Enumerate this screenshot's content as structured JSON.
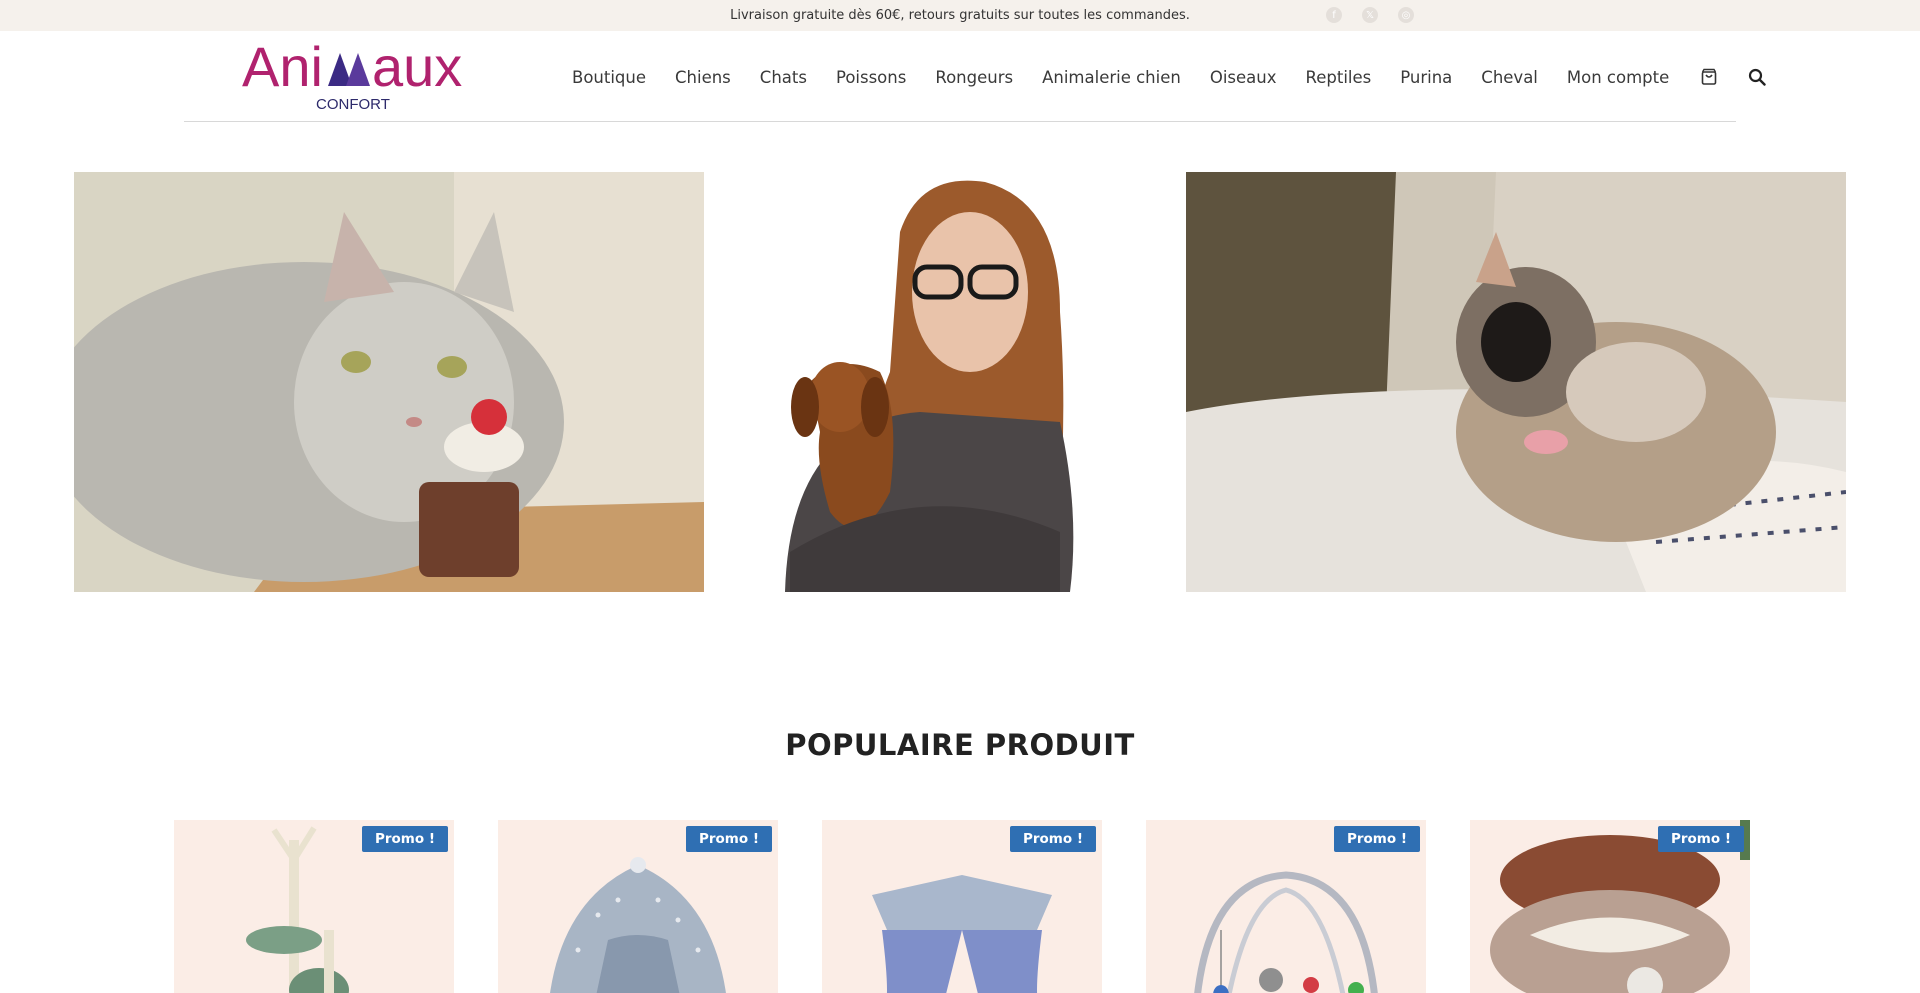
{
  "topbar": {
    "message": "Livraison gratuite dès 60€, retours gratuits sur toutes les commandes.",
    "social": [
      {
        "icon": "facebook-icon",
        "glyph": "f"
      },
      {
        "icon": "x-twitter-icon",
        "glyph": "𝕏"
      },
      {
        "icon": "instagram-icon",
        "glyph": "◎"
      }
    ]
  },
  "logo": {
    "brand": "Animaux",
    "tagline": "CONFORT",
    "colors": {
      "brand": "#b0226e",
      "accent": "#3b2a84",
      "tagline": "#2d2a6b"
    }
  },
  "nav": {
    "items": [
      "Boutique",
      "Chiens",
      "Chats",
      "Poissons",
      "Rongeurs",
      "Animalerie chien",
      "Oiseaux",
      "Reptiles",
      "Purina",
      "Cheval",
      "Mon compte"
    ],
    "cart_icon": "shopping-bag-icon",
    "search_icon": "search-icon"
  },
  "hero": {
    "images": [
      {
        "name": "cat-with-cake-image"
      },
      {
        "name": "woman-with-dachshund-image"
      },
      {
        "name": "puppy-on-couch-image"
      }
    ]
  },
  "section": {
    "title": "POPULAIRE PRODUIT"
  },
  "products": [
    {
      "badge": "Promo !",
      "image": "cat-tree-image"
    },
    {
      "badge": "Promo !",
      "image": "pet-tent-image"
    },
    {
      "badge": "Promo !",
      "image": "pet-teepee-image"
    },
    {
      "badge": "Promo !",
      "image": "cat-play-gym-image"
    },
    {
      "badge": "Promo !",
      "image": "cat-tunnel-bed-image"
    }
  ],
  "colors": {
    "topbar_bg": "#f5f1ec",
    "promo_badge": "#2f6fb3",
    "product_bg": "#fbede6"
  }
}
